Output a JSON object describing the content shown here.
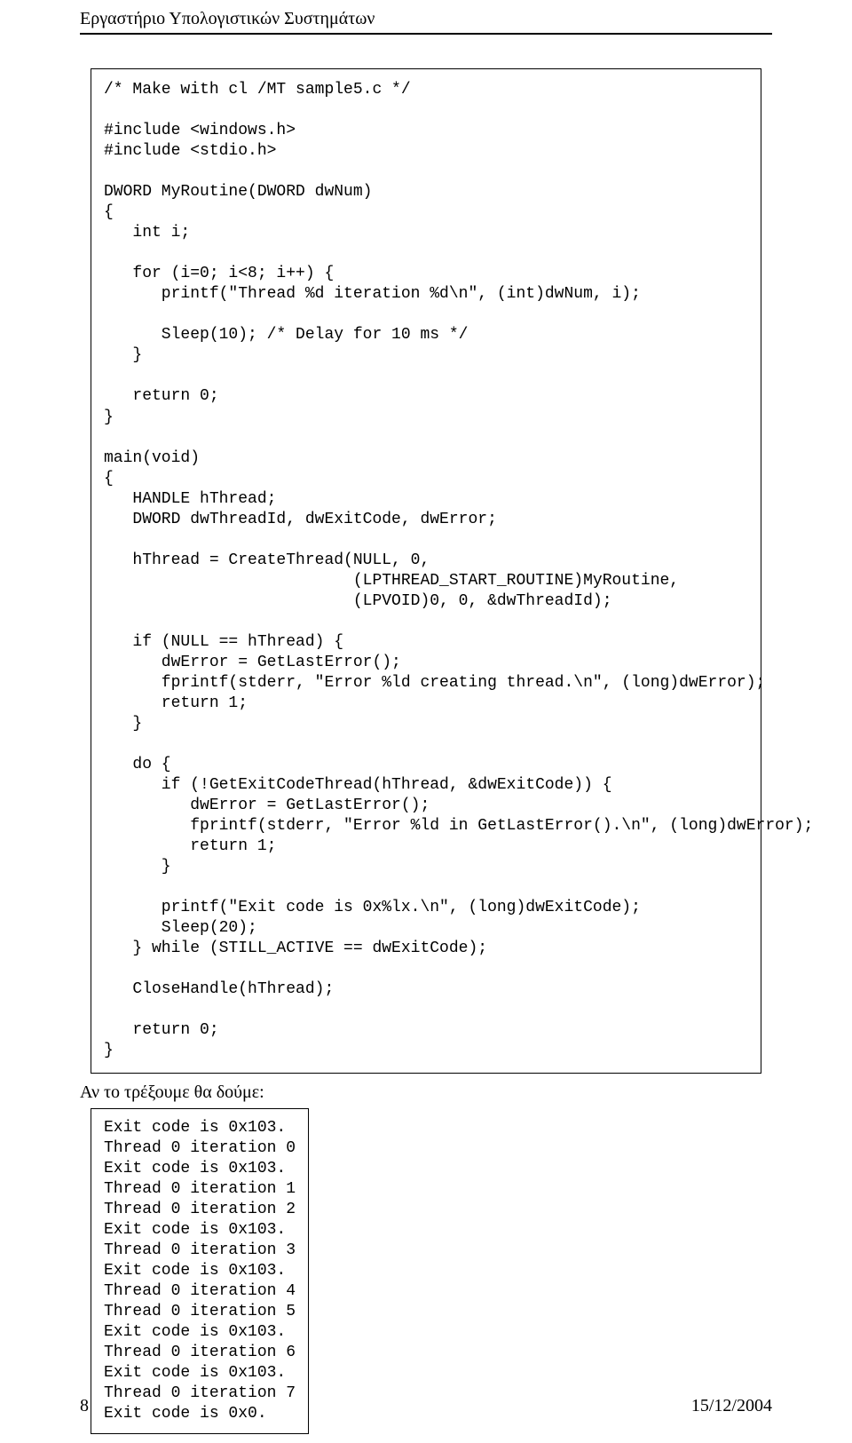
{
  "header": {
    "title": "Εργαστήριο Υπολογιστικών Συστημάτων"
  },
  "code": {
    "content": "/* Make with cl /MT sample5.c */\n\n#include <windows.h>\n#include <stdio.h>\n\nDWORD MyRoutine(DWORD dwNum)\n{\n   int i;\n\n   for (i=0; i<8; i++) {\n      printf(\"Thread %d iteration %d\\n\", (int)dwNum, i);\n\n      Sleep(10); /* Delay for 10 ms */\n   }\n\n   return 0;\n}\n\nmain(void)\n{\n   HANDLE hThread;\n   DWORD dwThreadId, dwExitCode, dwError;\n\n   hThread = CreateThread(NULL, 0,\n                          (LPTHREAD_START_ROUTINE)MyRoutine,\n                          (LPVOID)0, 0, &dwThreadId);\n\n   if (NULL == hThread) {\n      dwError = GetLastError();\n      fprintf(stderr, \"Error %ld creating thread.\\n\", (long)dwError);\n      return 1;\n   }\n\n   do {\n      if (!GetExitCodeThread(hThread, &dwExitCode)) {\n         dwError = GetLastError();\n         fprintf(stderr, \"Error %ld in GetLastError().\\n\", (long)dwError);\n         return 1;\n      }\n\n      printf(\"Exit code is 0x%lx.\\n\", (long)dwExitCode);\n      Sleep(20);\n   } while (STILL_ACTIVE == dwExitCode);\n\n   CloseHandle(hThread);\n\n   return 0;\n}"
  },
  "body": {
    "run_text": "Αν το τρέξουμε θα δούμε:"
  },
  "output": {
    "content": "Exit code is 0x103.\nThread 0 iteration 0\nExit code is 0x103.\nThread 0 iteration 1\nThread 0 iteration 2\nExit code is 0x103.\nThread 0 iteration 3\nExit code is 0x103.\nThread 0 iteration 4\nThread 0 iteration 5\nExit code is 0x103.\nThread 0 iteration 6\nExit code is 0x103.\nThread 0 iteration 7\nExit code is 0x0."
  },
  "footer": {
    "page_number": "8",
    "date": "15/12/2004"
  }
}
